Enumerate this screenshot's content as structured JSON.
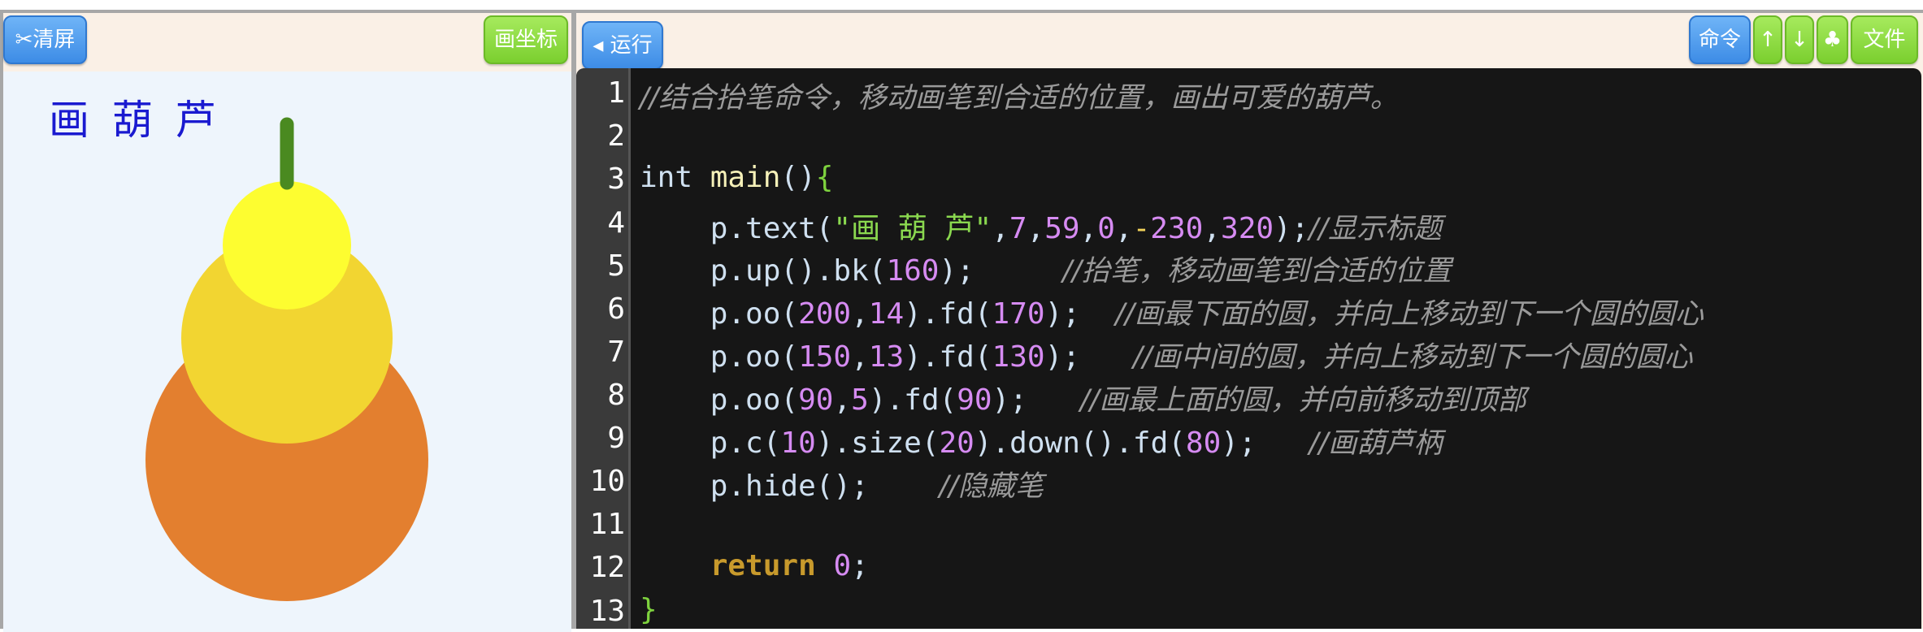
{
  "left_panel": {
    "clear_button": "✂清屏",
    "coord_button": "画坐标",
    "canvas_title": "画 葫 芦"
  },
  "right_panel": {
    "run_button": "◂ 运行",
    "command_button": "命令",
    "up_button": "↑",
    "down_button": "↓",
    "club_button": "♣",
    "file_button": "文件"
  },
  "colors": {
    "gourd_bottom": "#e37f2f",
    "gourd_middle": "#f2d531",
    "gourd_top": "#fdfd30",
    "stem": "#4a8a20"
  },
  "editor": {
    "line_numbers": [
      "1",
      "2",
      "3",
      "4",
      "5",
      "6",
      "7",
      "8",
      "9",
      "10",
      "11",
      "12",
      "13"
    ],
    "lines": [
      {
        "n": 1,
        "segs": [
          {
            "t": "cm",
            "v": "//结合抬笔命令，移动画笔到合适的位置，画出可爱的葫芦。"
          }
        ]
      },
      {
        "n": 2,
        "segs": []
      },
      {
        "n": 3,
        "segs": [
          {
            "t": "id",
            "v": "int "
          },
          {
            "t": "fn",
            "v": "main"
          },
          {
            "t": "id",
            "v": "()"
          },
          {
            "t": "brace",
            "v": "{"
          }
        ]
      },
      {
        "n": 4,
        "segs": [
          {
            "t": "id",
            "v": "    p.text("
          },
          {
            "t": "str",
            "v": "\"画 葫 芦\""
          },
          {
            "t": "id",
            "v": ","
          },
          {
            "t": "num",
            "v": "7"
          },
          {
            "t": "id",
            "v": ","
          },
          {
            "t": "num",
            "v": "59"
          },
          {
            "t": "id",
            "v": ","
          },
          {
            "t": "num",
            "v": "0"
          },
          {
            "t": "id",
            "v": ","
          },
          {
            "t": "op",
            "v": "-"
          },
          {
            "t": "num",
            "v": "230"
          },
          {
            "t": "id",
            "v": ","
          },
          {
            "t": "num",
            "v": "320"
          },
          {
            "t": "id",
            "v": ");"
          },
          {
            "t": "cm",
            "v": "//显示标题"
          }
        ]
      },
      {
        "n": 5,
        "segs": [
          {
            "t": "id",
            "v": "    p.up().bk("
          },
          {
            "t": "num",
            "v": "160"
          },
          {
            "t": "id",
            "v": ");     "
          },
          {
            "t": "cm",
            "v": "//抬笔，移动画笔到合适的位置"
          }
        ]
      },
      {
        "n": 6,
        "segs": [
          {
            "t": "id",
            "v": "    p.oo("
          },
          {
            "t": "num",
            "v": "200"
          },
          {
            "t": "id",
            "v": ","
          },
          {
            "t": "num",
            "v": "14"
          },
          {
            "t": "id",
            "v": ").fd("
          },
          {
            "t": "num",
            "v": "170"
          },
          {
            "t": "id",
            "v": ");  "
          },
          {
            "t": "cm",
            "v": "//画最下面的圆，并向上移动到下一个圆的圆心"
          }
        ]
      },
      {
        "n": 7,
        "segs": [
          {
            "t": "id",
            "v": "    p.oo("
          },
          {
            "t": "num",
            "v": "150"
          },
          {
            "t": "id",
            "v": ","
          },
          {
            "t": "num",
            "v": "13"
          },
          {
            "t": "id",
            "v": ").fd("
          },
          {
            "t": "num",
            "v": "130"
          },
          {
            "t": "id",
            "v": ");   "
          },
          {
            "t": "cm",
            "v": "//画中间的圆，并向上移动到下一个圆的圆心"
          }
        ]
      },
      {
        "n": 8,
        "segs": [
          {
            "t": "id",
            "v": "    p.oo("
          },
          {
            "t": "num",
            "v": "90"
          },
          {
            "t": "id",
            "v": ","
          },
          {
            "t": "num",
            "v": "5"
          },
          {
            "t": "id",
            "v": ").fd("
          },
          {
            "t": "num",
            "v": "90"
          },
          {
            "t": "id",
            "v": ");   "
          },
          {
            "t": "cm",
            "v": "//画最上面的圆，并向前移动到顶部"
          }
        ]
      },
      {
        "n": 9,
        "segs": [
          {
            "t": "id",
            "v": "    p.c("
          },
          {
            "t": "num",
            "v": "10"
          },
          {
            "t": "id",
            "v": ").size("
          },
          {
            "t": "num",
            "v": "20"
          },
          {
            "t": "id",
            "v": ").down().fd("
          },
          {
            "t": "num",
            "v": "80"
          },
          {
            "t": "id",
            "v": ");   "
          },
          {
            "t": "cm",
            "v": "//画葫芦柄"
          }
        ]
      },
      {
        "n": 10,
        "segs": [
          {
            "t": "id",
            "v": "    p.hide();    "
          },
          {
            "t": "cm",
            "v": "//隐藏笔"
          }
        ]
      },
      {
        "n": 11,
        "segs": []
      },
      {
        "n": 12,
        "segs": [
          {
            "t": "id",
            "v": "    "
          },
          {
            "t": "kw",
            "v": "return"
          },
          {
            "t": "id",
            "v": " "
          },
          {
            "t": "num",
            "v": "0"
          },
          {
            "t": "id",
            "v": ";"
          }
        ]
      },
      {
        "n": 13,
        "segs": [
          {
            "t": "brace",
            "v": "}"
          }
        ]
      }
    ]
  }
}
